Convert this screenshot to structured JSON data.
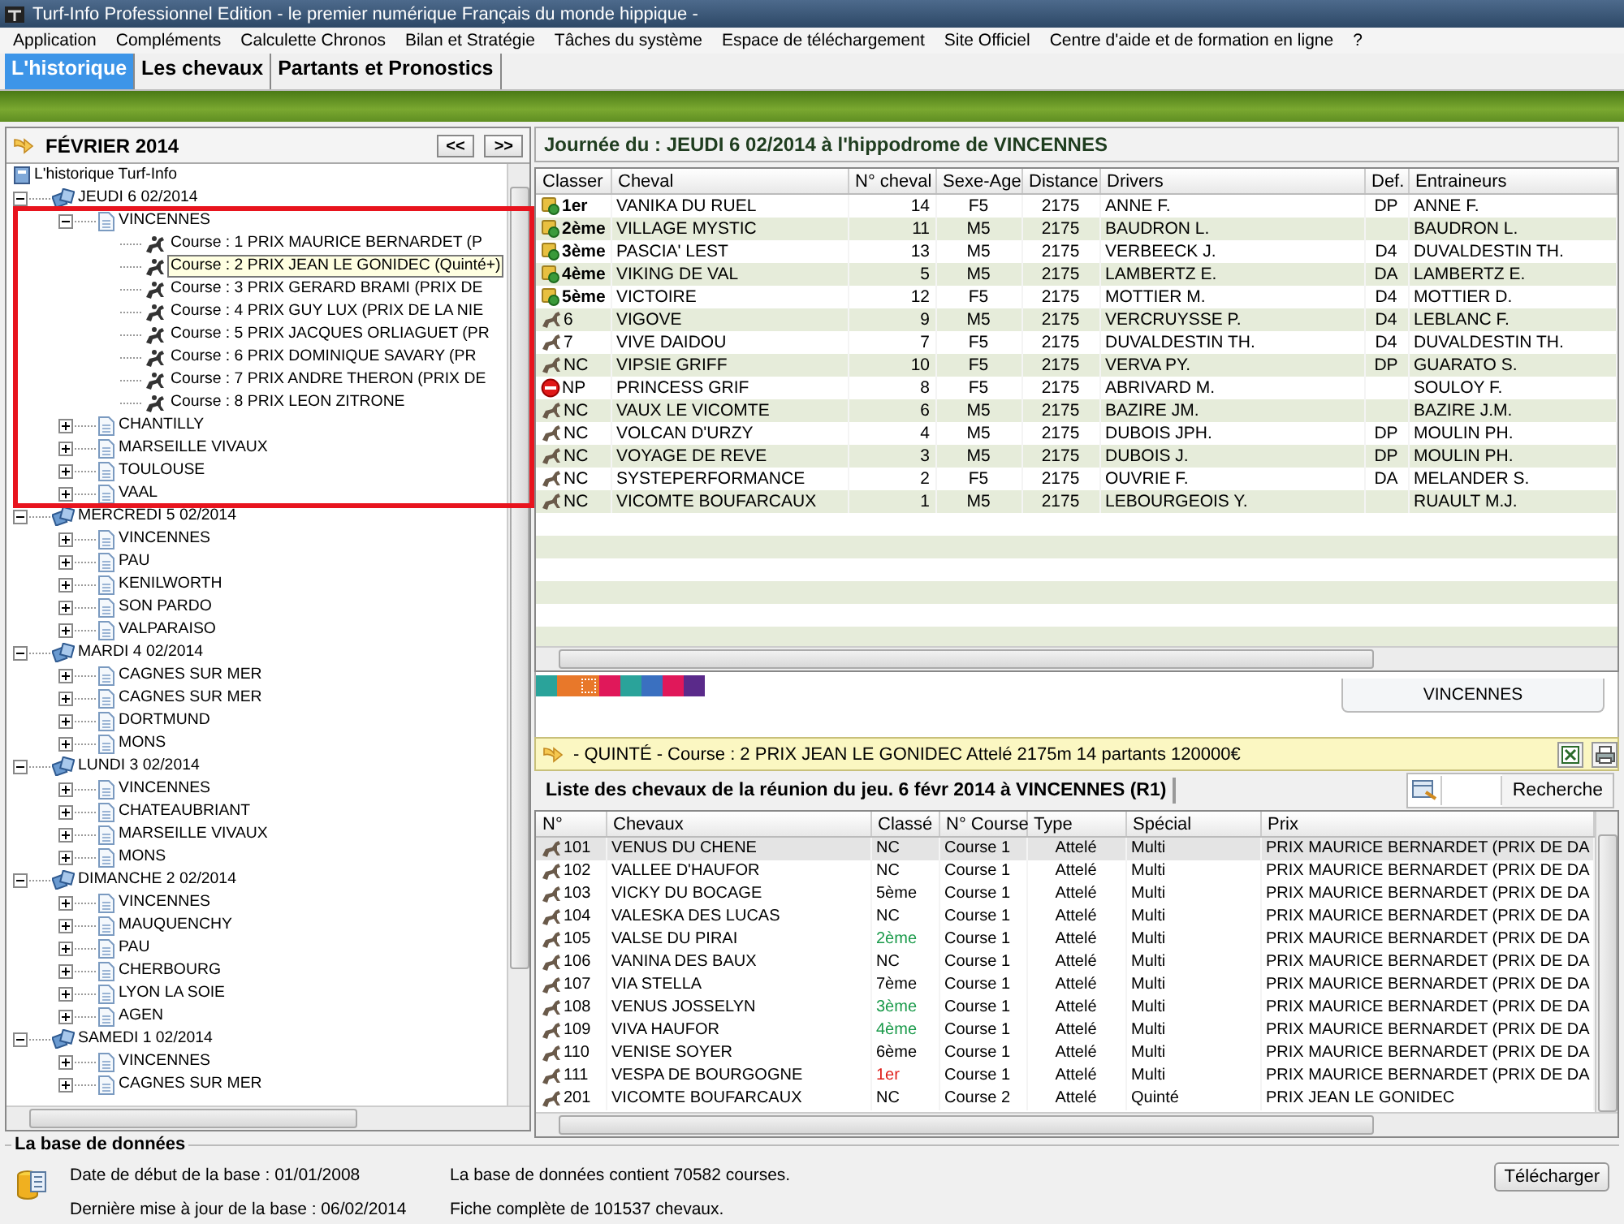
{
  "window": {
    "title": "Turf-Info Professionnel Edition - le premier numérique Français du monde hippique -"
  },
  "menu": [
    "Application",
    "Compléments",
    "Calculette Chronos",
    "Bilan et Stratégie",
    "Tâches du système",
    "Espace de téléchargement",
    "Site Officiel",
    "Centre d'aide et de formation en ligne",
    "?"
  ],
  "tabs": [
    {
      "label": "L'historique",
      "selected": true
    },
    {
      "label": "Les chevaux",
      "selected": false
    },
    {
      "label": "Partants et Pronostics",
      "selected": false
    }
  ],
  "calendar": {
    "month": "FÉVRIER 2014",
    "prev": "<<",
    "next": ">>"
  },
  "tree": {
    "label": "L'historique Turf-Info",
    "kind": "root",
    "selected": false,
    "children": [
      {
        "label": "JEUDI 6 02/2014",
        "kind": "day",
        "expanded": true,
        "selected": false,
        "children": [
          {
            "label": "VINCENNES",
            "kind": "venue",
            "expanded": true,
            "selected": false,
            "children": [
              {
                "label": "Course : 1 PRIX MAURICE BERNARDET (P",
                "kind": "course",
                "selected": false
              },
              {
                "label": "Course : 2 PRIX JEAN LE GONIDEC (Quinté+)",
                "kind": "course",
                "selected": true
              },
              {
                "label": "Course : 3 PRIX GERARD BRAMI (PRIX DE",
                "kind": "course",
                "selected": false
              },
              {
                "label": "Course : 4 PRIX GUY LUX (PRIX DE LA NIE",
                "kind": "course",
                "selected": false
              },
              {
                "label": "Course : 5 PRIX JACQUES ORLIAGUET (PR",
                "kind": "course",
                "selected": false
              },
              {
                "label": "Course : 6 PRIX DOMINIQUE SAVARY (PR",
                "kind": "course",
                "selected": false
              },
              {
                "label": "Course : 7 PRIX ANDRE THERON (PRIX DE",
                "kind": "course",
                "selected": false
              },
              {
                "label": "Course : 8 PRIX LEON ZITRONE",
                "kind": "course",
                "selected": false
              }
            ]
          },
          {
            "label": "CHANTILLY",
            "kind": "venue",
            "expanded": false,
            "selected": false
          },
          {
            "label": "MARSEILLE VIVAUX",
            "kind": "venue",
            "expanded": false,
            "selected": false
          },
          {
            "label": "TOULOUSE",
            "kind": "venue",
            "expanded": false,
            "selected": false
          },
          {
            "label": "VAAL",
            "kind": "venue",
            "expanded": false,
            "selected": false
          }
        ]
      },
      {
        "label": "MERCREDI 5 02/2014",
        "kind": "day",
        "expanded": true,
        "selected": false,
        "children": [
          {
            "label": "VINCENNES",
            "kind": "venue",
            "expanded": false,
            "selected": false
          },
          {
            "label": "PAU",
            "kind": "venue",
            "expanded": false,
            "selected": false
          },
          {
            "label": "KENILWORTH",
            "kind": "venue",
            "expanded": false,
            "selected": false
          },
          {
            "label": "SON PARDO",
            "kind": "venue",
            "expanded": false,
            "selected": false
          },
          {
            "label": "VALPARAISO",
            "kind": "venue",
            "expanded": false,
            "selected": false
          }
        ]
      },
      {
        "label": "MARDI 4 02/2014",
        "kind": "day",
        "expanded": true,
        "selected": false,
        "children": [
          {
            "label": "CAGNES SUR MER",
            "kind": "venue",
            "expanded": false,
            "selected": false
          },
          {
            "label": "CAGNES SUR MER",
            "kind": "venue",
            "expanded": false,
            "selected": false
          },
          {
            "label": "DORTMUND",
            "kind": "venue",
            "expanded": false,
            "selected": false
          },
          {
            "label": "MONS",
            "kind": "venue",
            "expanded": false,
            "selected": false
          }
        ]
      },
      {
        "label": "LUNDI 3 02/2014",
        "kind": "day",
        "expanded": true,
        "selected": false,
        "children": [
          {
            "label": "VINCENNES",
            "kind": "venue",
            "expanded": false,
            "selected": false
          },
          {
            "label": "CHATEAUBRIANT",
            "kind": "venue",
            "expanded": false,
            "selected": false
          },
          {
            "label": "MARSEILLE VIVAUX",
            "kind": "venue",
            "expanded": false,
            "selected": false
          },
          {
            "label": "MONS",
            "kind": "venue",
            "expanded": false,
            "selected": false
          }
        ]
      },
      {
        "label": "DIMANCHE 2 02/2014",
        "kind": "day",
        "expanded": true,
        "selected": false,
        "children": [
          {
            "label": "VINCENNES",
            "kind": "venue",
            "expanded": false,
            "selected": false
          },
          {
            "label": "MAUQUENCHY",
            "kind": "venue",
            "expanded": false,
            "selected": false
          },
          {
            "label": "PAU",
            "kind": "venue",
            "expanded": false,
            "selected": false
          },
          {
            "label": "CHERBOURG",
            "kind": "venue",
            "expanded": false,
            "selected": false
          },
          {
            "label": "LYON LA SOIE",
            "kind": "venue",
            "expanded": false,
            "selected": false
          },
          {
            "label": "AGEN",
            "kind": "venue",
            "expanded": false,
            "selected": false
          }
        ]
      },
      {
        "label": "SAMEDI 1 02/2014",
        "kind": "day",
        "expanded": true,
        "selected": false,
        "children": [
          {
            "label": "VINCENNES",
            "kind": "venue",
            "expanded": false,
            "selected": false
          },
          {
            "label": "CAGNES SUR MER",
            "kind": "venue",
            "expanded": false,
            "selected": false
          }
        ]
      }
    ]
  },
  "results": {
    "title": "Journée du : JEUDI 6 02/2014 à l'hippodrome de VINCENNES",
    "columns": [
      "Classer",
      "Cheval",
      "N° cheval",
      "Sexe-Age",
      "Distance",
      "Drivers",
      "Def.",
      "Entraineurs"
    ],
    "rows": [
      {
        "kind": "placed",
        "classer": "1er",
        "cheval": "VANIKA DU RUEL",
        "numero": "14",
        "sexe_age": "F5",
        "distance": "2175",
        "driver": "ANNE F.",
        "def": "DP",
        "entraineur": "ANNE F."
      },
      {
        "kind": "placed",
        "classer": "2ème",
        "cheval": "VILLAGE MYSTIC",
        "numero": "11",
        "sexe_age": "M5",
        "distance": "2175",
        "driver": "BAUDRON L.",
        "entraineur": "BAUDRON L."
      },
      {
        "kind": "placed",
        "classer": "3ème",
        "cheval": "PASCIA' LEST",
        "numero": "13",
        "sexe_age": "M5",
        "distance": "2175",
        "driver": "VERBEECK J.",
        "def": "D4",
        "entraineur": "DUVALDESTIN TH."
      },
      {
        "kind": "placed",
        "classer": "4ème",
        "cheval": "VIKING DE VAL",
        "numero": "5",
        "sexe_age": "M5",
        "distance": "2175",
        "driver": "LAMBERTZ E.",
        "def": "DA",
        "entraineur": "LAMBERTZ E."
      },
      {
        "kind": "placed",
        "classer": "5ème",
        "cheval": "VICTOIRE",
        "numero": "12",
        "sexe_age": "F5",
        "distance": "2175",
        "driver": "MOTTIER M.",
        "def": "D4",
        "entraineur": "MOTTIER D."
      },
      {
        "kind": "finished",
        "classer": "6",
        "cheval": "VIGOVE",
        "numero": "9",
        "sexe_age": "M5",
        "distance": "2175",
        "driver": "VERCRUYSSE P.",
        "def": "D4",
        "entraineur": "LEBLANC F."
      },
      {
        "kind": "finished",
        "classer": "7",
        "cheval": "VIVE DAIDOU",
        "numero": "7",
        "sexe_age": "F5",
        "distance": "2175",
        "driver": "DUVALDESTIN TH.",
        "def": "D4",
        "entraineur": "DUVALDESTIN TH."
      },
      {
        "kind": "finished",
        "classer": "NC",
        "cheval": "VIPSIE GRIFF",
        "numero": "10",
        "sexe_age": "F5",
        "distance": "2175",
        "driver": "VERVA PY.",
        "def": "DP",
        "entraineur": "GUARATO S."
      },
      {
        "kind": "nonstarter",
        "classer": "NP",
        "cheval": "PRINCESS GRIF",
        "numero": "8",
        "sexe_age": "F5",
        "distance": "2175",
        "driver": "ABRIVARD M.",
        "entraineur": "SOULOY F."
      },
      {
        "kind": "finished",
        "classer": "NC",
        "cheval": "VAUX LE VICOMTE",
        "numero": "6",
        "sexe_age": "M5",
        "distance": "2175",
        "driver": "BAZIRE JM.",
        "entraineur": "BAZIRE J.M."
      },
      {
        "kind": "finished",
        "classer": "NC",
        "cheval": "VOLCAN D'URZY",
        "numero": "4",
        "sexe_age": "M5",
        "distance": "2175",
        "driver": "DUBOIS JPH.",
        "def": "DP",
        "entraineur": "MOULIN PH."
      },
      {
        "kind": "finished",
        "classer": "NC",
        "cheval": "VOYAGE DE REVE",
        "numero": "3",
        "sexe_age": "M5",
        "distance": "2175",
        "driver": "DUBOIS J.",
        "def": "DP",
        "entraineur": "MOULIN PH."
      },
      {
        "kind": "finished",
        "classer": "NC",
        "cheval": "SYSTEPERFORMANCE",
        "numero": "2",
        "sexe_age": "F5",
        "distance": "2175",
        "driver": "OUVRIE F.",
        "def": "DA",
        "entraineur": "MELANDER S."
      },
      {
        "kind": "finished",
        "classer": "NC",
        "cheval": "VICOMTE BOUFARCAUX",
        "numero": "1",
        "sexe_age": "M5",
        "distance": "2175",
        "driver": "LEBOURGEOIS Y.",
        "entraineur": "RUAULT M.J."
      }
    ]
  },
  "color_tabs": [
    {
      "color": "#2aa39a",
      "selected": false
    },
    {
      "color": "#e8782a",
      "selected": false
    },
    {
      "color": "#e8782a",
      "selected": true
    },
    {
      "color": "#e0185a",
      "selected": false
    },
    {
      "color": "#2aa39a",
      "selected": false
    },
    {
      "color": "#3a70c0",
      "selected": false
    },
    {
      "color": "#e0185a",
      "selected": false
    },
    {
      "color": "#5a2a8a",
      "selected": false
    }
  ],
  "venue_tabs": [
    {
      "label": "VINCENNES",
      "selected": true
    }
  ],
  "race_banner": "- QUINTÉ - Course : 2 PRIX JEAN LE GONIDEC Attelé 2175m 14 partants 120000€",
  "horse_list": {
    "tab": "Liste des chevaux de la réunion du jeu. 6 févr 2014 à VINCENNES (R1)",
    "search_button": "Recherche",
    "columns": [
      "N°",
      "Chevaux",
      "Classé",
      "N° Course",
      "Type",
      "Spécial",
      "Prix"
    ],
    "rows": [
      {
        "numero": "101",
        "cheval": "VENUS DU CHENE",
        "classe": "NC",
        "color": "#000000",
        "course": "Course 1",
        "type": "Attelé",
        "special": "Multi",
        "prix": "PRIX MAURICE BERNARDET (PRIX DE DA",
        "selected": true
      },
      {
        "numero": "102",
        "cheval": "VALLEE D'HAUFOR",
        "classe": "NC",
        "color": "#000000",
        "course": "Course 1",
        "type": "Attelé",
        "special": "Multi",
        "prix": "PRIX MAURICE BERNARDET (PRIX DE DA",
        "selected": false
      },
      {
        "numero": "103",
        "cheval": "VICKY DU BOCAGE",
        "classe": "5ème",
        "color": "#000000",
        "course": "Course 1",
        "type": "Attelé",
        "special": "Multi",
        "prix": "PRIX MAURICE BERNARDET (PRIX DE DA",
        "selected": false
      },
      {
        "numero": "104",
        "cheval": "VALESKA DES LUCAS",
        "classe": "NC",
        "color": "#000000",
        "course": "Course 1",
        "type": "Attelé",
        "special": "Multi",
        "prix": "PRIX MAURICE BERNARDET (PRIX DE DA",
        "selected": false
      },
      {
        "numero": "105",
        "cheval": "VALSE DU PIRAI",
        "classe": "2ème",
        "color": "#1a9a4a",
        "course": "Course 1",
        "type": "Attelé",
        "special": "Multi",
        "prix": "PRIX MAURICE BERNARDET (PRIX DE DA",
        "selected": false
      },
      {
        "numero": "106",
        "cheval": "VANINA DES BAUX",
        "classe": "NC",
        "color": "#000000",
        "course": "Course 1",
        "type": "Attelé",
        "special": "Multi",
        "prix": "PRIX MAURICE BERNARDET (PRIX DE DA",
        "selected": false
      },
      {
        "numero": "107",
        "cheval": "VIA STELLA",
        "classe": "7ème",
        "color": "#000000",
        "course": "Course 1",
        "type": "Attelé",
        "special": "Multi",
        "prix": "PRIX MAURICE BERNARDET (PRIX DE DA",
        "selected": false
      },
      {
        "numero": "108",
        "cheval": "VENUS JOSSELYN",
        "classe": "3ème",
        "color": "#1a9a4a",
        "course": "Course 1",
        "type": "Attelé",
        "special": "Multi",
        "prix": "PRIX MAURICE BERNARDET (PRIX DE DA",
        "selected": false
      },
      {
        "numero": "109",
        "cheval": "VIVA HAUFOR",
        "classe": "4ème",
        "color": "#1a9a4a",
        "course": "Course 1",
        "type": "Attelé",
        "special": "Multi",
        "prix": "PRIX MAURICE BERNARDET (PRIX DE DA",
        "selected": false
      },
      {
        "numero": "110",
        "cheval": "VENISE SOYER",
        "classe": "6ème",
        "color": "#000000",
        "course": "Course 1",
        "type": "Attelé",
        "special": "Multi",
        "prix": "PRIX MAURICE BERNARDET (PRIX DE DA",
        "selected": false
      },
      {
        "numero": "111",
        "cheval": "VESPA DE BOURGOGNE",
        "classe": "1er",
        "color": "#e0201a",
        "course": "Course 1",
        "type": "Attelé",
        "special": "Multi",
        "prix": "PRIX MAURICE BERNARDET (PRIX DE DA",
        "selected": false
      },
      {
        "numero": "201",
        "cheval": "VICOMTE BOUFARCAUX",
        "classe": "NC",
        "color": "#000000",
        "course": "Course 2",
        "type": "Attelé",
        "special": "Quinté",
        "prix": "PRIX JEAN LE GONIDEC",
        "selected": false
      }
    ]
  },
  "database": {
    "title": "La base de données",
    "start": "Date de début de la base :  01/01/2008",
    "update": "Dernière mise à jour de la base : 06/02/2014",
    "courses": "La base de données contient 70582 courses.",
    "horses": "Fiche complète de 101537 chevaux.",
    "button": "Télécharger"
  }
}
